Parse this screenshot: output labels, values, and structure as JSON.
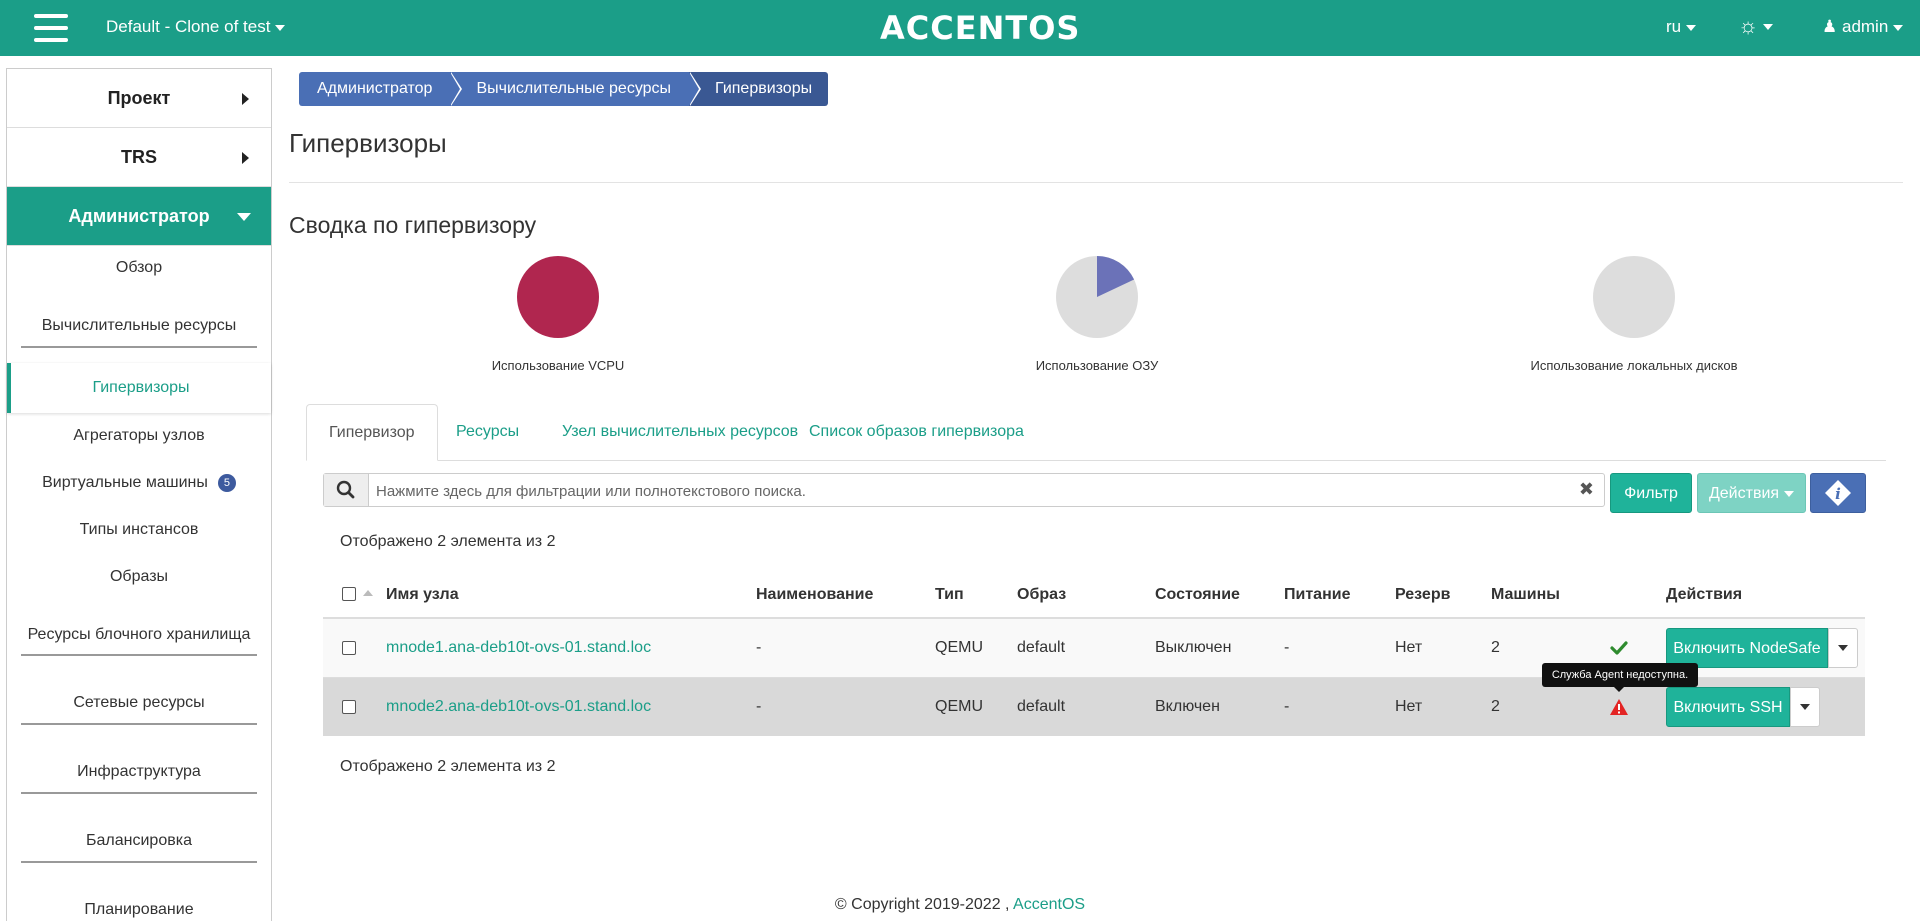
{
  "header": {
    "project": "Default - Clone of test",
    "logo": "ACCENTOS",
    "language": "ru",
    "user": "admin",
    "brand_color": "#1b9e88"
  },
  "sidebar": {
    "sections": [
      {
        "label": "Проект"
      },
      {
        "label": "TRS"
      },
      {
        "label": "Администратор"
      }
    ],
    "items": [
      {
        "label": "Обзор"
      },
      {
        "label": "Вычислительные ресурсы"
      },
      {
        "label": "Гипервизоры"
      },
      {
        "label": "Агрегаторы узлов"
      },
      {
        "label": "Виртуальные машины",
        "badge": "5"
      },
      {
        "label": "Типы инстансов"
      },
      {
        "label": "Образы"
      },
      {
        "label": "Ресурсы блочного хранилища"
      },
      {
        "label": "Сетевые ресурсы"
      },
      {
        "label": "Инфраструктура"
      },
      {
        "label": "Балансировка"
      },
      {
        "label": "Планирование"
      }
    ]
  },
  "breadcrumb": [
    "Администратор",
    "Вычислительные ресурсы",
    "Гипервизоры"
  ],
  "page_title": "Гипервизоры",
  "summary": {
    "title": "Сводка по гипервизору",
    "charts": [
      {
        "label": "Использование VCPU",
        "used_fraction": 1.0,
        "color": "#b0264f"
      },
      {
        "label": "Использование ОЗУ",
        "used_fraction": 0.18,
        "color": "#6b72b8"
      },
      {
        "label": "Использование локальных дисков",
        "used_fraction": 0.0,
        "color": "#dddddd"
      }
    ]
  },
  "tabs": [
    "Гипервизор",
    "Ресурсы",
    "Узел вычислительных ресурсов",
    "Список образов гипервизора"
  ],
  "search": {
    "placeholder": "Нажмите здесь для фильтрации или полнотекстового поиска."
  },
  "buttons": {
    "filter": "Фильтр",
    "actions": "Действия"
  },
  "count_text": "Отображено 2 элемента из 2",
  "table": {
    "columns": [
      "Имя узла",
      "Наименование",
      "Тип",
      "Образ",
      "Состояние",
      "Питание",
      "Резерв",
      "Машины",
      "Действия"
    ],
    "rows": [
      {
        "name": "mnode1.ana-deb10t-ovs-01.stand.loc",
        "title": "-",
        "type": "QEMU",
        "image": "default",
        "state": "Выключен",
        "power": "-",
        "reserve": "Нет",
        "machines": "2",
        "agent": "ok",
        "action": "Включить NodeSafe"
      },
      {
        "name": "mnode2.ana-deb10t-ovs-01.stand.loc",
        "title": "-",
        "type": "QEMU",
        "image": "default",
        "state": "Включен",
        "power": "-",
        "reserve": "Нет",
        "machines": "2",
        "agent": "warning",
        "action": "Включить SSH"
      }
    ],
    "tooltip": "Служба Agent недоступна."
  },
  "footer": {
    "copyright": "© Copyright 2019-2022 ,",
    "link": "AccentOS"
  }
}
